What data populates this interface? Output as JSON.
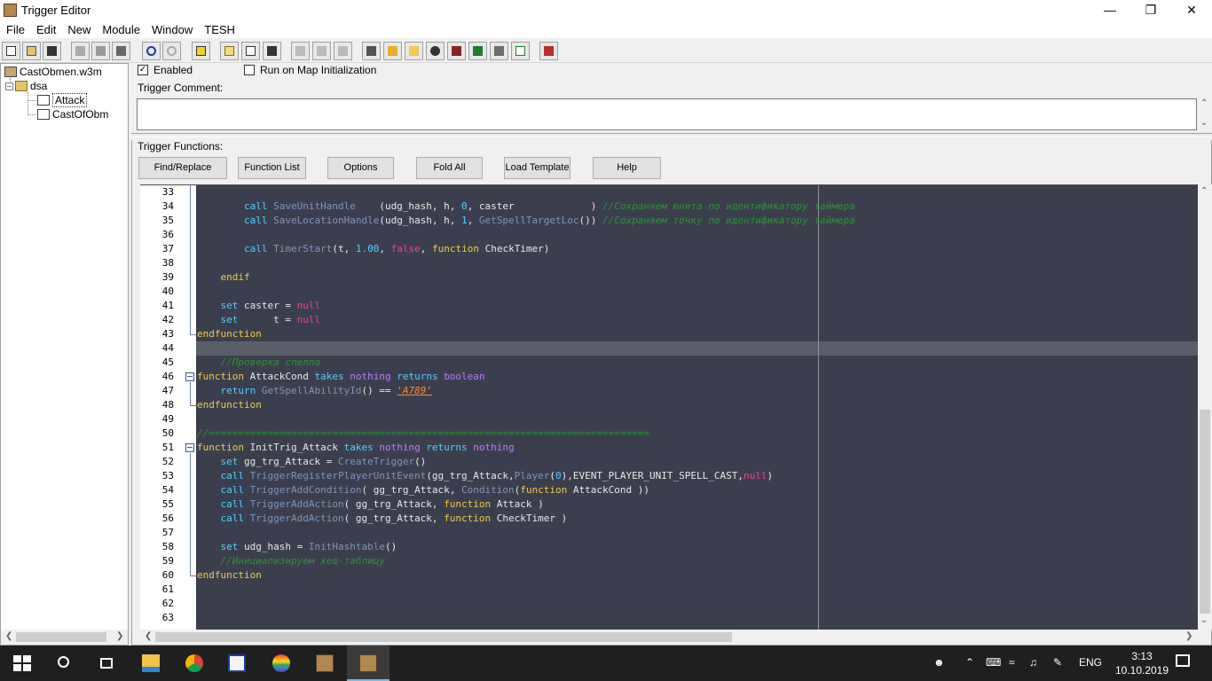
{
  "window": {
    "title": "Trigger Editor"
  },
  "menu": [
    "File",
    "Edit",
    "New",
    "Module",
    "Window",
    "TESH"
  ],
  "tree": {
    "map": "CastObmen.w3m",
    "folder": "dsa",
    "triggers": [
      "Attack",
      "CastOfObm"
    ],
    "selected": "Attack"
  },
  "trigger": {
    "enabled_label": "Enabled",
    "enabled": true,
    "run_init_label": "Run on Map Initialization",
    "run_init": false,
    "comment_label": "Trigger Comment:",
    "comment": "",
    "functions_label": "Trigger Functions:"
  },
  "buttons": [
    "Find/Replace",
    "Function List",
    "Options",
    "Fold All",
    "Load Template",
    "Help"
  ],
  "code": {
    "first_line": 33,
    "last_line": 63,
    "highlighted_line": 44
  },
  "taskbar": {
    "language": "ENG",
    "time": "3:13",
    "date": "10.10.2019"
  }
}
